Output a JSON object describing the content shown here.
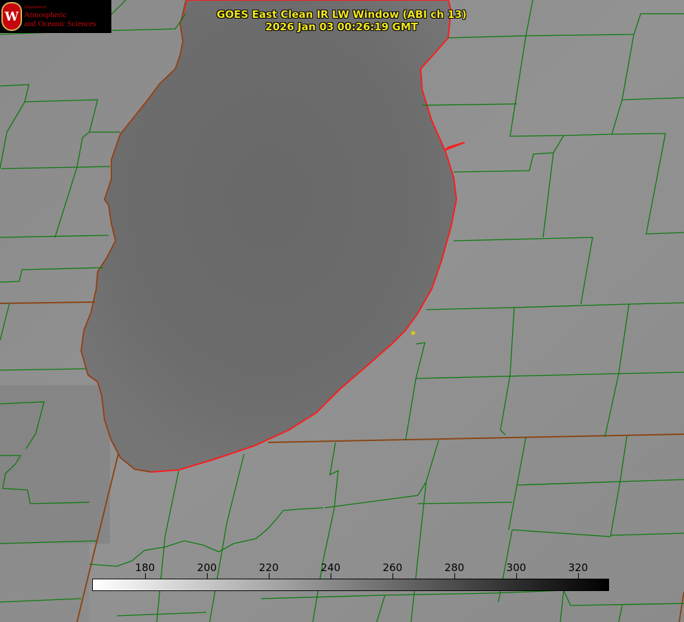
{
  "logo": {
    "seal_letter": "W",
    "department": "Department of",
    "line1": "Atmospheric",
    "line2": "and Oceanic Sciences"
  },
  "title": {
    "line1": "GOES East Clean IR LW Window (ABI ch 13)",
    "line2": "2026 Jan 03 00:26:19 GMT"
  },
  "colorbar": {
    "ticks": [
      "180",
      "200",
      "220",
      "240",
      "260",
      "280",
      "300",
      "320"
    ],
    "min_value": 163,
    "max_value": 330,
    "color_start": "#ffffff",
    "color_end": "#000000"
  },
  "colors": {
    "county_lines": "#0a7a0a",
    "state_lines": "#8b4513",
    "lake_shore": "#ff1a1a",
    "title_text": "#f2e61e",
    "land": "#8c8c8c",
    "lake": "#6c6c6c"
  }
}
